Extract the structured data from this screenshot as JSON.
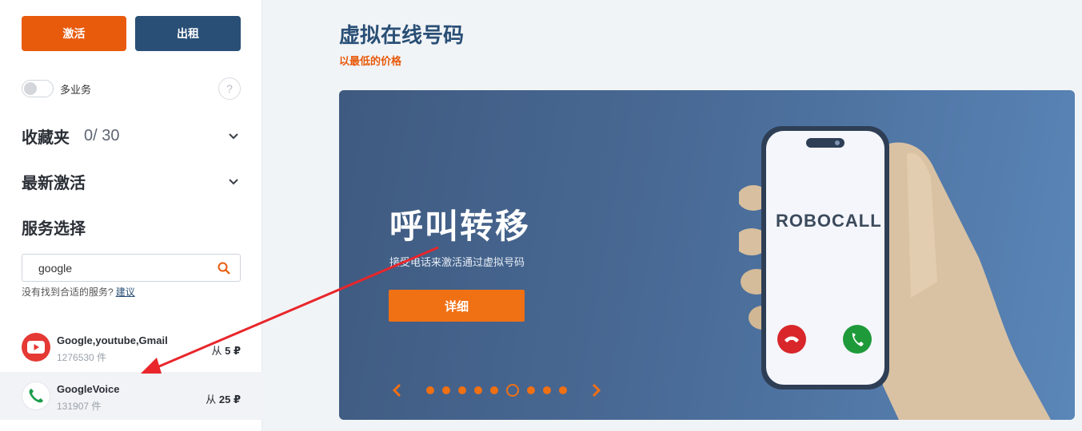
{
  "sidebar": {
    "activate_label": "激活",
    "rent_label": "出租",
    "multi_service_label": "多业务",
    "help_label": "?",
    "favorites": {
      "title": "收藏夹",
      "count": "0/ 30"
    },
    "recent_title": "最新激活",
    "service_select_title": "服务选择",
    "search": {
      "value": "google",
      "placeholder": ""
    },
    "not_found_text": "没有找到合适的服务?",
    "suggest_link": "建议",
    "services": [
      {
        "name": "Google,youtube,Gmail",
        "count": "1276530 件",
        "price_prefix": "从",
        "price": "5 ₽",
        "icon": "youtube-icon"
      },
      {
        "name": "GoogleVoice",
        "count": "131907 件",
        "price_prefix": "从",
        "price": "25 ₽",
        "icon": "google-voice-icon"
      }
    ]
  },
  "main": {
    "title": "虚拟在线号码",
    "subtitle": "以最低的价格",
    "banner": {
      "title": "呼叫转移",
      "subtitle": "接受电话来激活通过虚拟号码",
      "button_label": "详细",
      "phone_text": "ROBOCALL",
      "total_slides": 9,
      "active_slide": 6
    }
  },
  "colors": {
    "accent_orange": "#e85a0c",
    "navy": "#294f76",
    "annotation_red": "#e8262b"
  }
}
